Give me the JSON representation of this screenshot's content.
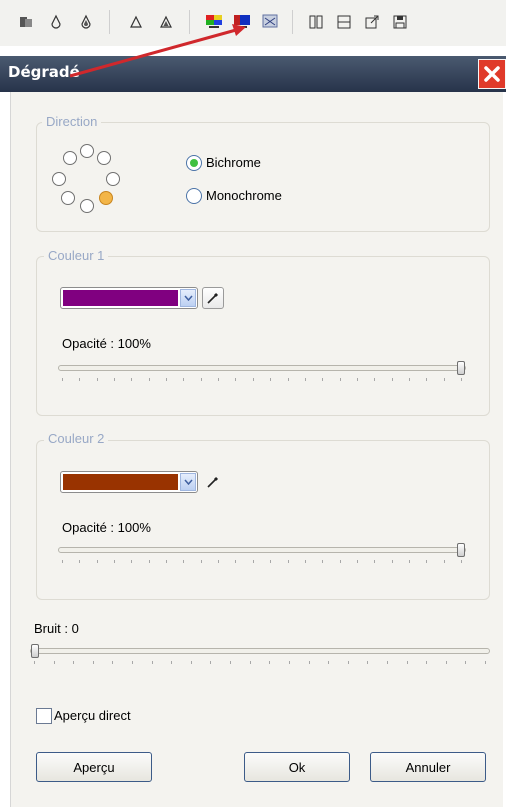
{
  "toolbar": {
    "icons": [
      "copy-icon",
      "drop-icon",
      "drops-icon",
      "triangle-icon",
      "triangles-icon",
      "gradient-multicolor-icon",
      "gradient-blue-icon",
      "noise-icon",
      "columns-icon",
      "rows-icon",
      "export-icon",
      "save-icon"
    ]
  },
  "dialog": {
    "title": "Dégradé",
    "direction": {
      "legend": "Direction",
      "options": [
        "Bichrome",
        "Monochrome"
      ],
      "selected": "Bichrome"
    },
    "couleur1": {
      "legend": "Couleur 1",
      "color": "#800080",
      "opacity_label": "Opacité : 100%",
      "opacity": 1.0
    },
    "couleur2": {
      "legend": "Couleur 2",
      "color": "#993300",
      "opacity_label": "Opacité : 100%",
      "opacity": 1.0
    },
    "bruit": {
      "label": "Bruit : 0",
      "value": 0.0
    },
    "apercu_direct": {
      "label": "Aperçu direct",
      "checked": false
    },
    "buttons": {
      "apercu": "Aperçu",
      "ok": "Ok",
      "annuler": "Annuler"
    }
  },
  "colors": {
    "arrow": "#d0282c",
    "close": "#e03a2a",
    "radio_selected": "#40c040"
  }
}
